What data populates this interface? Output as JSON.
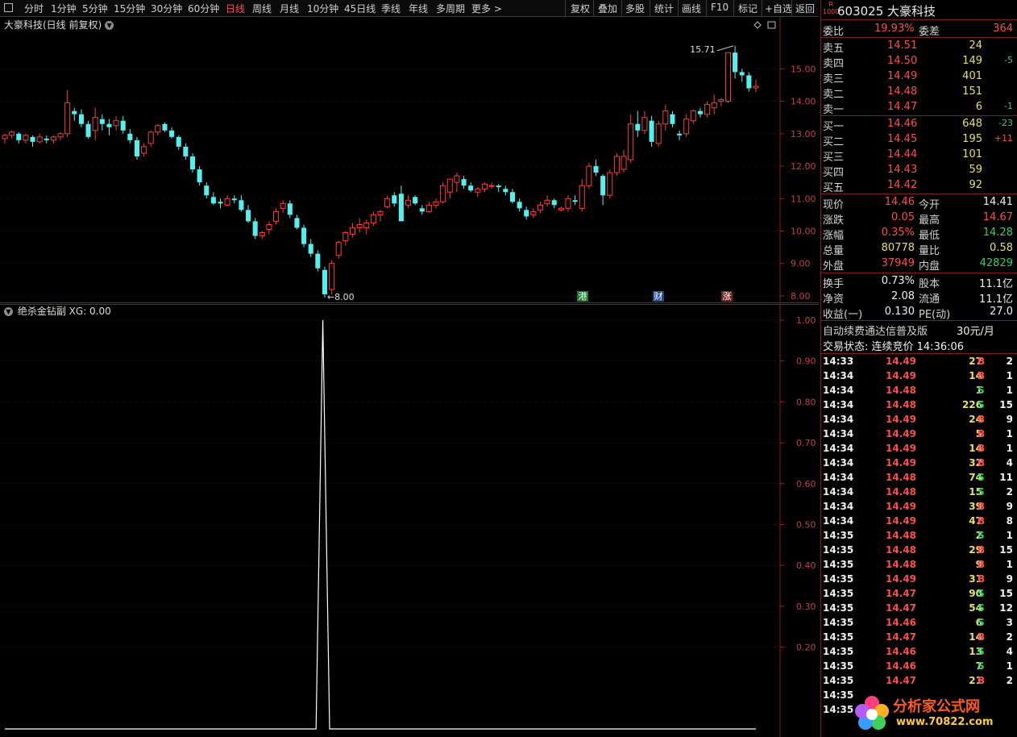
{
  "toolbar": {
    "periods": [
      "分时",
      "1分钟",
      "5分钟",
      "15分钟",
      "30分钟",
      "60分钟",
      "日线",
      "周线",
      "月线",
      "10分钟",
      "45日线",
      "季线",
      "年线",
      "多周期",
      "更多"
    ],
    "active_period": "日线",
    "more_arrow": ">",
    "tools": [
      "复权",
      "叠加",
      "多股",
      "统计",
      "画线",
      "F10",
      "标记",
      "+自选",
      "返回"
    ]
  },
  "main_chart": {
    "title": "大豪科技(日线 前复权)",
    "high_label": "15.71",
    "low_label": "8.00",
    "tags": [
      {
        "text": "港",
        "color": "#1f7a2a"
      },
      {
        "text": "财",
        "color": "#1e4a8c"
      },
      {
        "text": "涨",
        "color": "#7a1f1f"
      }
    ],
    "corner_icons": [
      "diamond-icon",
      "window-icon"
    ]
  },
  "indicator": {
    "title": "绝杀金钻副",
    "value_label": "XG: 0.00"
  },
  "chart_data": [
    {
      "type": "candlestick",
      "title": "大豪科技(日线 前复权)",
      "y_ticks": [
        "15.00",
        "14.00",
        "13.00",
        "12.00",
        "11.00",
        "10.00",
        "9.00",
        "8.00"
      ],
      "ylim": [
        7.8,
        16.6
      ],
      "up_color": "#ff3b3b",
      "down_color": "#54f0f0",
      "candles": [
        [
          12.85,
          13.0,
          12.7,
          12.95
        ],
        [
          12.95,
          13.1,
          12.85,
          13.05
        ],
        [
          13.0,
          13.05,
          12.7,
          12.8
        ],
        [
          12.8,
          13.0,
          12.7,
          12.95
        ],
        [
          12.9,
          12.95,
          12.6,
          12.75
        ],
        [
          12.75,
          13.0,
          12.7,
          12.9
        ],
        [
          12.85,
          12.95,
          12.7,
          12.8
        ],
        [
          12.8,
          12.95,
          12.7,
          12.9
        ],
        [
          12.9,
          13.05,
          12.8,
          13.0
        ],
        [
          13.0,
          14.35,
          12.9,
          13.95
        ],
        [
          13.7,
          13.8,
          13.4,
          13.6
        ],
        [
          13.6,
          13.75,
          13.2,
          13.3
        ],
        [
          13.3,
          13.4,
          12.85,
          12.9
        ],
        [
          13.1,
          13.8,
          12.8,
          13.5
        ],
        [
          13.45,
          13.6,
          13.1,
          13.3
        ],
        [
          13.3,
          13.45,
          12.95,
          13.2
        ],
        [
          13.25,
          13.55,
          13.1,
          13.4
        ],
        [
          13.4,
          13.55,
          13.0,
          13.1
        ],
        [
          13.0,
          13.15,
          12.7,
          12.8
        ],
        [
          12.8,
          12.9,
          12.2,
          12.3
        ],
        [
          12.4,
          12.7,
          12.3,
          12.6
        ],
        [
          12.7,
          13.1,
          12.6,
          13.05
        ],
        [
          13.05,
          13.3,
          12.95,
          13.25
        ],
        [
          13.3,
          13.35,
          13.05,
          13.1
        ],
        [
          13.1,
          13.2,
          12.85,
          12.9
        ],
        [
          12.9,
          12.95,
          12.5,
          12.6
        ],
        [
          12.6,
          12.7,
          12.2,
          12.3
        ],
        [
          12.3,
          12.4,
          11.8,
          11.9
        ],
        [
          11.9,
          12.0,
          11.4,
          11.5
        ],
        [
          11.4,
          11.5,
          11.0,
          11.1
        ],
        [
          11.05,
          11.2,
          10.8,
          10.85
        ],
        [
          10.9,
          11.0,
          10.7,
          10.85
        ],
        [
          10.8,
          11.1,
          10.75,
          11.0
        ],
        [
          11.0,
          11.1,
          10.85,
          10.95
        ],
        [
          10.95,
          11.1,
          10.6,
          10.65
        ],
        [
          10.65,
          10.8,
          10.25,
          10.3
        ],
        [
          10.3,
          10.4,
          9.75,
          9.85
        ],
        [
          9.85,
          10.0,
          9.75,
          9.95
        ],
        [
          10.05,
          10.3,
          9.9,
          10.2
        ],
        [
          10.3,
          10.7,
          10.2,
          10.6
        ],
        [
          10.7,
          10.95,
          10.55,
          10.85
        ],
        [
          10.85,
          10.95,
          10.4,
          10.5
        ],
        [
          10.4,
          10.5,
          10.05,
          10.1
        ],
        [
          10.1,
          10.2,
          9.5,
          9.6
        ],
        [
          9.6,
          9.75,
          9.2,
          9.3
        ],
        [
          9.3,
          9.4,
          8.75,
          8.85
        ],
        [
          8.8,
          8.9,
          7.95,
          8.05
        ],
        [
          8.2,
          9.1,
          8.05,
          9.0
        ],
        [
          9.25,
          9.7,
          9.15,
          9.65
        ],
        [
          9.7,
          10.0,
          9.55,
          9.95
        ],
        [
          9.9,
          10.25,
          9.8,
          10.1
        ],
        [
          10.1,
          10.4,
          9.95,
          10.2
        ],
        [
          10.1,
          10.35,
          9.9,
          10.25
        ],
        [
          10.25,
          10.6,
          10.15,
          10.5
        ],
        [
          10.5,
          10.65,
          10.3,
          10.6
        ],
        [
          10.75,
          11.1,
          10.7,
          11.0
        ],
        [
          11.1,
          11.2,
          10.75,
          10.85
        ],
        [
          11.15,
          11.4,
          10.7,
          10.3
        ],
        [
          10.8,
          11.1,
          10.7,
          10.95
        ],
        [
          11.05,
          11.1,
          10.8,
          10.85
        ],
        [
          10.7,
          10.8,
          10.5,
          10.6
        ],
        [
          10.6,
          10.9,
          10.55,
          10.8
        ],
        [
          10.8,
          11.0,
          10.7,
          10.9
        ],
        [
          10.9,
          11.5,
          10.85,
          11.4
        ],
        [
          11.2,
          11.5,
          11.0,
          11.6
        ],
        [
          11.5,
          11.8,
          11.2,
          11.7
        ],
        [
          11.6,
          11.7,
          11.3,
          11.4
        ],
        [
          11.4,
          11.5,
          11.2,
          11.25
        ],
        [
          11.2,
          11.35,
          11.05,
          11.3
        ],
        [
          11.3,
          11.5,
          11.2,
          11.45
        ],
        [
          11.4,
          11.5,
          11.3,
          11.4
        ],
        [
          11.4,
          11.45,
          11.2,
          11.35
        ],
        [
          11.3,
          11.4,
          11.1,
          11.2
        ],
        [
          11.2,
          11.3,
          10.85,
          10.9
        ],
        [
          10.9,
          11.0,
          10.6,
          10.7
        ],
        [
          10.65,
          10.75,
          10.35,
          10.45
        ],
        [
          10.5,
          10.7,
          10.4,
          10.6
        ],
        [
          10.65,
          10.9,
          10.55,
          10.8
        ],
        [
          10.85,
          11.1,
          10.75,
          10.95
        ],
        [
          10.95,
          11.0,
          10.7,
          10.8
        ],
        [
          10.65,
          10.75,
          10.6,
          10.7
        ],
        [
          10.7,
          11.1,
          10.6,
          11.0
        ],
        [
          10.95,
          11.1,
          10.8,
          10.9
        ],
        [
          10.7,
          11.6,
          10.6,
          11.4
        ],
        [
          11.4,
          12.1,
          11.3,
          12.0
        ],
        [
          12.0,
          12.2,
          11.7,
          11.8
        ],
        [
          11.7,
          11.75,
          10.8,
          11.1
        ],
        [
          11.1,
          11.9,
          11.0,
          11.8
        ],
        [
          11.8,
          12.4,
          11.7,
          12.3
        ],
        [
          11.9,
          12.5,
          11.8,
          12.3
        ],
        [
          12.2,
          13.6,
          12.1,
          13.3
        ],
        [
          13.3,
          13.7,
          12.9,
          13.1
        ],
        [
          13.1,
          13.7,
          13.0,
          13.5
        ],
        [
          13.4,
          13.55,
          12.6,
          12.75
        ],
        [
          12.7,
          13.4,
          12.6,
          13.3
        ],
        [
          13.3,
          13.9,
          13.1,
          13.7
        ],
        [
          13.6,
          13.7,
          13.2,
          13.3
        ],
        [
          13.0,
          13.1,
          12.8,
          12.95
        ],
        [
          13.0,
          13.6,
          12.9,
          13.45
        ],
        [
          13.4,
          13.75,
          13.3,
          13.7
        ],
        [
          13.7,
          13.8,
          13.5,
          13.6
        ],
        [
          13.6,
          14.0,
          13.5,
          13.9
        ],
        [
          13.8,
          14.2,
          13.6,
          13.95
        ],
        [
          14.0,
          14.1,
          13.85,
          14.05
        ],
        [
          14.0,
          14.8,
          13.95,
          15.5
        ],
        [
          15.5,
          15.71,
          14.7,
          14.9
        ],
        [
          14.9,
          15.0,
          14.6,
          14.8
        ],
        [
          14.8,
          14.9,
          14.3,
          14.4
        ],
        [
          14.41,
          14.67,
          14.28,
          14.46
        ]
      ]
    },
    {
      "type": "line",
      "title": "绝杀金钻副",
      "series": [
        {
          "name": "XG",
          "values": [
            0,
            0,
            0,
            0,
            0,
            0,
            0,
            0,
            0,
            0,
            0,
            0,
            0,
            0,
            0,
            0,
            0,
            0,
            0,
            0,
            0,
            0,
            0,
            0,
            0,
            0,
            0,
            0,
            0,
            0,
            0,
            0,
            0,
            0,
            0,
            0,
            0,
            0,
            0,
            0,
            0,
            0,
            0,
            0,
            0,
            0,
            0,
            1,
            0,
            0,
            0,
            0,
            0,
            0,
            0,
            0,
            0,
            0,
            0,
            0,
            0,
            0,
            0,
            0,
            0,
            0,
            0,
            0,
            0,
            0,
            0,
            0,
            0,
            0,
            0,
            0,
            0,
            0,
            0,
            0,
            0,
            0,
            0,
            0,
            0,
            0,
            0,
            0,
            0,
            0,
            0,
            0,
            0,
            0,
            0,
            0,
            0,
            0,
            0,
            0,
            0,
            0,
            0,
            0,
            0,
            0,
            0,
            0,
            0,
            0,
            0,
            0
          ]
        }
      ],
      "y_ticks": [
        "1.00",
        "0.90",
        "0.80",
        "0.70",
        "0.60",
        "0.50",
        "0.40",
        "0.30",
        "0.20"
      ],
      "ylim": [
        0,
        1.0
      ],
      "line_color": "#ffffff"
    }
  ],
  "quote": {
    "code": "603025",
    "name": "大豪科技",
    "badge_top": "R",
    "badge_bottom": "1000",
    "weibi_label": "委比",
    "weibi": "19.93%",
    "weicha_label": "委差",
    "weicha": "364",
    "asks": [
      {
        "label": "卖五",
        "price": "14.51",
        "vol": "24",
        "chg": ""
      },
      {
        "label": "卖四",
        "price": "14.50",
        "vol": "149",
        "chg": "-5"
      },
      {
        "label": "卖三",
        "price": "14.49",
        "vol": "401",
        "chg": ""
      },
      {
        "label": "卖二",
        "price": "14.48",
        "vol": "151",
        "chg": ""
      },
      {
        "label": "卖一",
        "price": "14.47",
        "vol": "6",
        "chg": "-1"
      }
    ],
    "bids": [
      {
        "label": "买一",
        "price": "14.46",
        "vol": "648",
        "chg": "-23"
      },
      {
        "label": "买二",
        "price": "14.45",
        "vol": "195",
        "chg": "+11"
      },
      {
        "label": "买三",
        "price": "14.44",
        "vol": "101",
        "chg": ""
      },
      {
        "label": "买四",
        "price": "14.43",
        "vol": "59",
        "chg": ""
      },
      {
        "label": "买五",
        "price": "14.42",
        "vol": "92",
        "chg": ""
      }
    ],
    "stats": [
      {
        "l1": "现价",
        "v1": "14.46",
        "c1": "red",
        "l2": "今开",
        "v2": "14.41",
        "c2": "white"
      },
      {
        "l1": "涨跌",
        "v1": "0.05",
        "c1": "red",
        "l2": "最高",
        "v2": "14.67",
        "c2": "red"
      },
      {
        "l1": "涨幅",
        "v1": "0.35%",
        "c1": "red",
        "l2": "最低",
        "v2": "14.28",
        "c2": "green"
      },
      {
        "l1": "总量",
        "v1": "80778",
        "c1": "yellow",
        "l2": "量比",
        "v2": "0.58",
        "c2": "yellow"
      },
      {
        "l1": "外盘",
        "v1": "37949",
        "c1": "red",
        "l2": "内盘",
        "v2": "42829",
        "c2": "green"
      }
    ],
    "fund": [
      {
        "l1": "换手",
        "v1": "0.73%",
        "l2": "股本",
        "v2": "11.1亿"
      },
      {
        "l1": "净资",
        "v1": "2.08",
        "l2": "流通",
        "v2": "11.1亿"
      },
      {
        "l1": "收益(一)",
        "v1": "0.130",
        "l2": "PE(动)",
        "v2": "27.0"
      }
    ],
    "ad_text": "自动续费通达信普及版",
    "ad_price": "30元/月",
    "status": "交易状态: 连续竞价 14:36:06"
  },
  "ticks": [
    {
      "t": "14:33",
      "p": "14.49",
      "v": "27",
      "s": "B",
      "n": "2"
    },
    {
      "t": "14:34",
      "p": "14.49",
      "v": "14",
      "s": "B",
      "n": "1"
    },
    {
      "t": "14:34",
      "p": "14.48",
      "v": "1",
      "s": "S",
      "n": "1"
    },
    {
      "t": "14:34",
      "p": "14.48",
      "v": "226",
      "s": "S",
      "n": "15"
    },
    {
      "t": "14:34",
      "p": "14.49",
      "v": "24",
      "s": "B",
      "n": "9"
    },
    {
      "t": "14:34",
      "p": "14.49",
      "v": "5",
      "s": "B",
      "n": "1"
    },
    {
      "t": "14:34",
      "p": "14.49",
      "v": "14",
      "s": "B",
      "n": "1"
    },
    {
      "t": "14:34",
      "p": "14.49",
      "v": "32",
      "s": "B",
      "n": "4"
    },
    {
      "t": "14:34",
      "p": "14.48",
      "v": "74",
      "s": "S",
      "n": "11"
    },
    {
      "t": "14:34",
      "p": "14.48",
      "v": "15",
      "s": "S",
      "n": "2"
    },
    {
      "t": "14:34",
      "p": "14.49",
      "v": "39",
      "s": "B",
      "n": "9"
    },
    {
      "t": "14:34",
      "p": "14.49",
      "v": "47",
      "s": "B",
      "n": "8"
    },
    {
      "t": "14:35",
      "p": "14.48",
      "v": "2",
      "s": "S",
      "n": "1"
    },
    {
      "t": "14:35",
      "p": "14.48",
      "v": "29",
      "s": "B",
      "n": "15"
    },
    {
      "t": "14:35",
      "p": "14.48",
      "v": "9",
      "s": "B",
      "n": "1"
    },
    {
      "t": "14:35",
      "p": "14.49",
      "v": "31",
      "s": "B",
      "n": "9"
    },
    {
      "t": "14:35",
      "p": "14.47",
      "v": "90",
      "s": "S",
      "n": "15"
    },
    {
      "t": "14:35",
      "p": "14.47",
      "v": "54",
      "s": "S",
      "n": "12"
    },
    {
      "t": "14:35",
      "p": "14.46",
      "v": "6",
      "s": "S",
      "n": "3"
    },
    {
      "t": "14:35",
      "p": "14.47",
      "v": "14",
      "s": "B",
      "n": "2"
    },
    {
      "t": "14:35",
      "p": "14.46",
      "v": "13",
      "s": "S",
      "n": "4"
    },
    {
      "t": "14:35",
      "p": "14.46",
      "v": "7",
      "s": "S",
      "n": "1"
    },
    {
      "t": "14:35",
      "p": "14.47",
      "v": "21",
      "s": "B",
      "n": "2"
    },
    {
      "t": "14:35",
      "p": "",
      "v": "",
      "s": "",
      "n": ""
    },
    {
      "t": "14:35",
      "p": "",
      "v": "",
      "s": "",
      "n": ""
    }
  ],
  "watermark": {
    "title": "分析家公式网",
    "url": "www.70822.com"
  }
}
